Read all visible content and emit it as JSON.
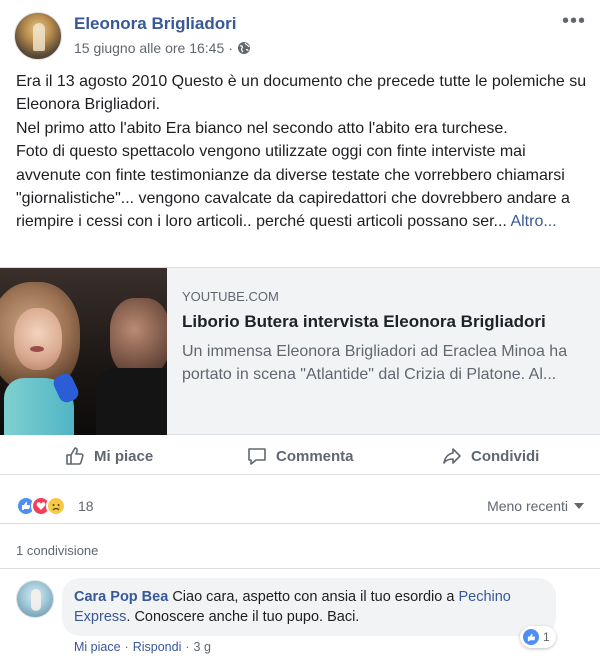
{
  "post": {
    "author": "Eleonora Brigliadori",
    "timestamp": "15 giugno alle ore 16:45",
    "separator": "·",
    "privacy_icon": "globe-icon",
    "more_icon": "more-options-icon",
    "text_lines": [
      "Era il 13 agosto 2010 Questo è un documento che precede tutte le polemiche su Eleonora Brigliadori.",
      "Nel primo atto l'abito Era bianco nel secondo atto l'abito era turchese.",
      "Foto di questo spettacolo vengono utilizzate oggi con finte interviste mai avvenute con finte testimonianze da diverse testate che vorrebbero chiamarsi \"giornalistiche\"... vengono cavalcate da capiredattori che dovrebbero andare a riempire i cessi con i loro articoli.. perché questi articoli possano ser..."
    ],
    "more_link": "Altro..."
  },
  "link_card": {
    "domain": "YOUTUBE.COM",
    "title": "Liborio Butera intervista Eleonora Brigliadori",
    "description": "Un immensa Eleonora Brigliadori ad Eraclea Minoa ha portato in scena \"Atlantide\" dal Crizia di Platone. Al..."
  },
  "actions": {
    "like": "Mi piace",
    "comment": "Commenta",
    "share": "Condividi"
  },
  "reactions": {
    "icons": [
      "like-icon",
      "love-icon",
      "sad-icon"
    ],
    "count": "18",
    "sort_label": "Meno recenti"
  },
  "shares": "1 condivisione",
  "comment": {
    "author": "Cara Pop Bea",
    "text_before": " Ciao cara, aspetto con ansia il tuo esordio a ",
    "link": "Pechino Express",
    "text_after": ". Conoscere anche il tuo pupo. Baci.",
    "reaction_count": "1",
    "like_label": "Mi piace",
    "reply_label": "Rispondi",
    "separator": "·",
    "time": "3 g"
  },
  "colors": {
    "link_blue": "#385898",
    "secondary_text": "#606770",
    "card_bg": "#f2f3f5",
    "like_blue": "#4f8ef5",
    "love_red": "#f33e58",
    "sad_yellow": "#f7c948"
  }
}
